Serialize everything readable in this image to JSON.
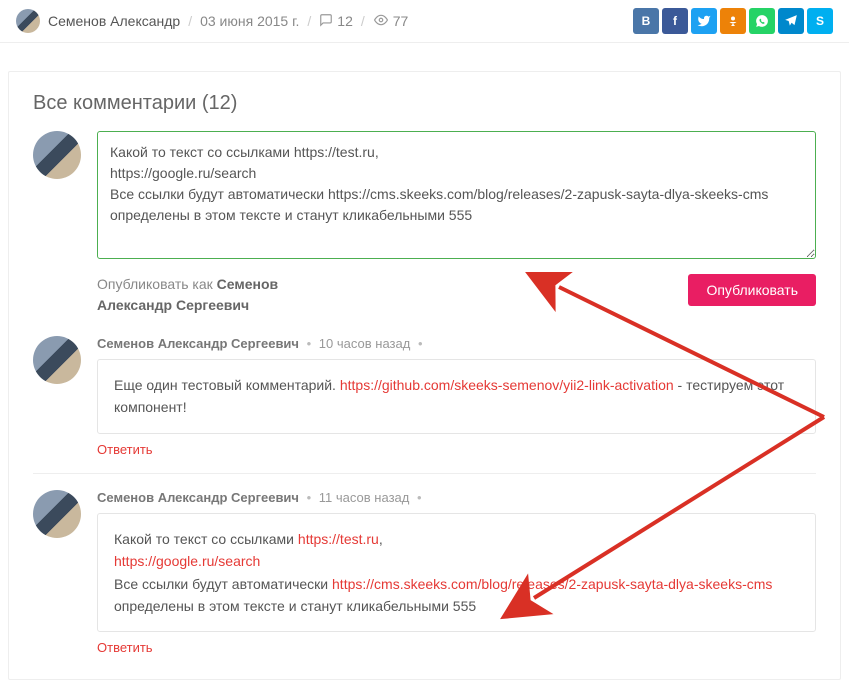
{
  "meta": {
    "author": "Семенов Александр",
    "date": "03 июня 2015 г.",
    "comments_count": "12",
    "views_count": "77"
  },
  "share": {
    "vk": "B",
    "fb": "f",
    "tw": "🐦",
    "ok": "OK",
    "wa": "✆",
    "tg": "➤",
    "sk": "S"
  },
  "comments_title": "Все комментарии (12)",
  "form": {
    "textarea_value": "Какой то текст со ссылками https://test.ru,\nhttps://google.ru/search\nВсе ссылки будут автоматически https://cms.skeeks.com/blog/releases/2-zapusk-sayta-dlya-skeeks-cms определены в этом тексте и станут кликабельными 555",
    "publish_as_prefix": "Опубликовать как ",
    "publish_as_name": "Семенов Александр Сергеевич",
    "publish_btn": "Опубликовать"
  },
  "comments": [
    {
      "author": "Семенов Александр Сергеевич",
      "time": "10 часов назад",
      "text_before": "Еще один тестовый комментарий. ",
      "link1": "https://github.com/skeeks-semenov/yii2-link-activation",
      "text_after": " - тестируем этот компонент!",
      "reply": "Ответить"
    },
    {
      "author": "Семенов Александр Сергеевич",
      "time": "11 часов назад",
      "p1_before": "Какой то текст со ссылками ",
      "p1_link1": "https://test.ru",
      "p1_after": ",",
      "p1_link2": "https://google.ru/search",
      "p2_before": "Все ссылки будут автоматически ",
      "p2_link": "https://cms.skeeks.com/blog/releases/2-zapusk-sayta-dlya-skeeks-cms",
      "p2_after": " определены в этом тексте и станут кликабельными 555",
      "reply": "Ответить"
    }
  ]
}
